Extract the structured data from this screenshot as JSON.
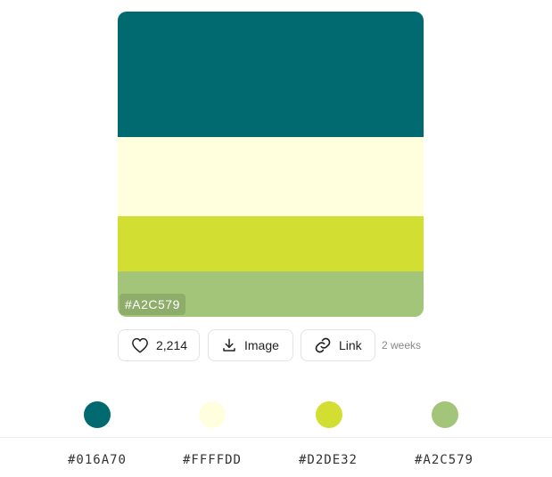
{
  "palette": {
    "colors": [
      "#016A70",
      "#FFFFDD",
      "#D2DE32",
      "#A2C579"
    ],
    "hover_label": "#A2C579"
  },
  "actions": {
    "likes": "2,214",
    "image_label": "Image",
    "link_label": "Link",
    "time_ago": "2 weeks"
  },
  "colors": [
    {
      "hex": "#016A70",
      "label": "#016A70"
    },
    {
      "hex": "#FFFFDD",
      "label": "#FFFFDD"
    },
    {
      "hex": "#D2DE32",
      "label": "#D2DE32"
    },
    {
      "hex": "#A2C579",
      "label": "#A2C579"
    }
  ],
  "icons": {
    "like": "heart-icon",
    "image": "download-icon",
    "link": "link-icon"
  }
}
